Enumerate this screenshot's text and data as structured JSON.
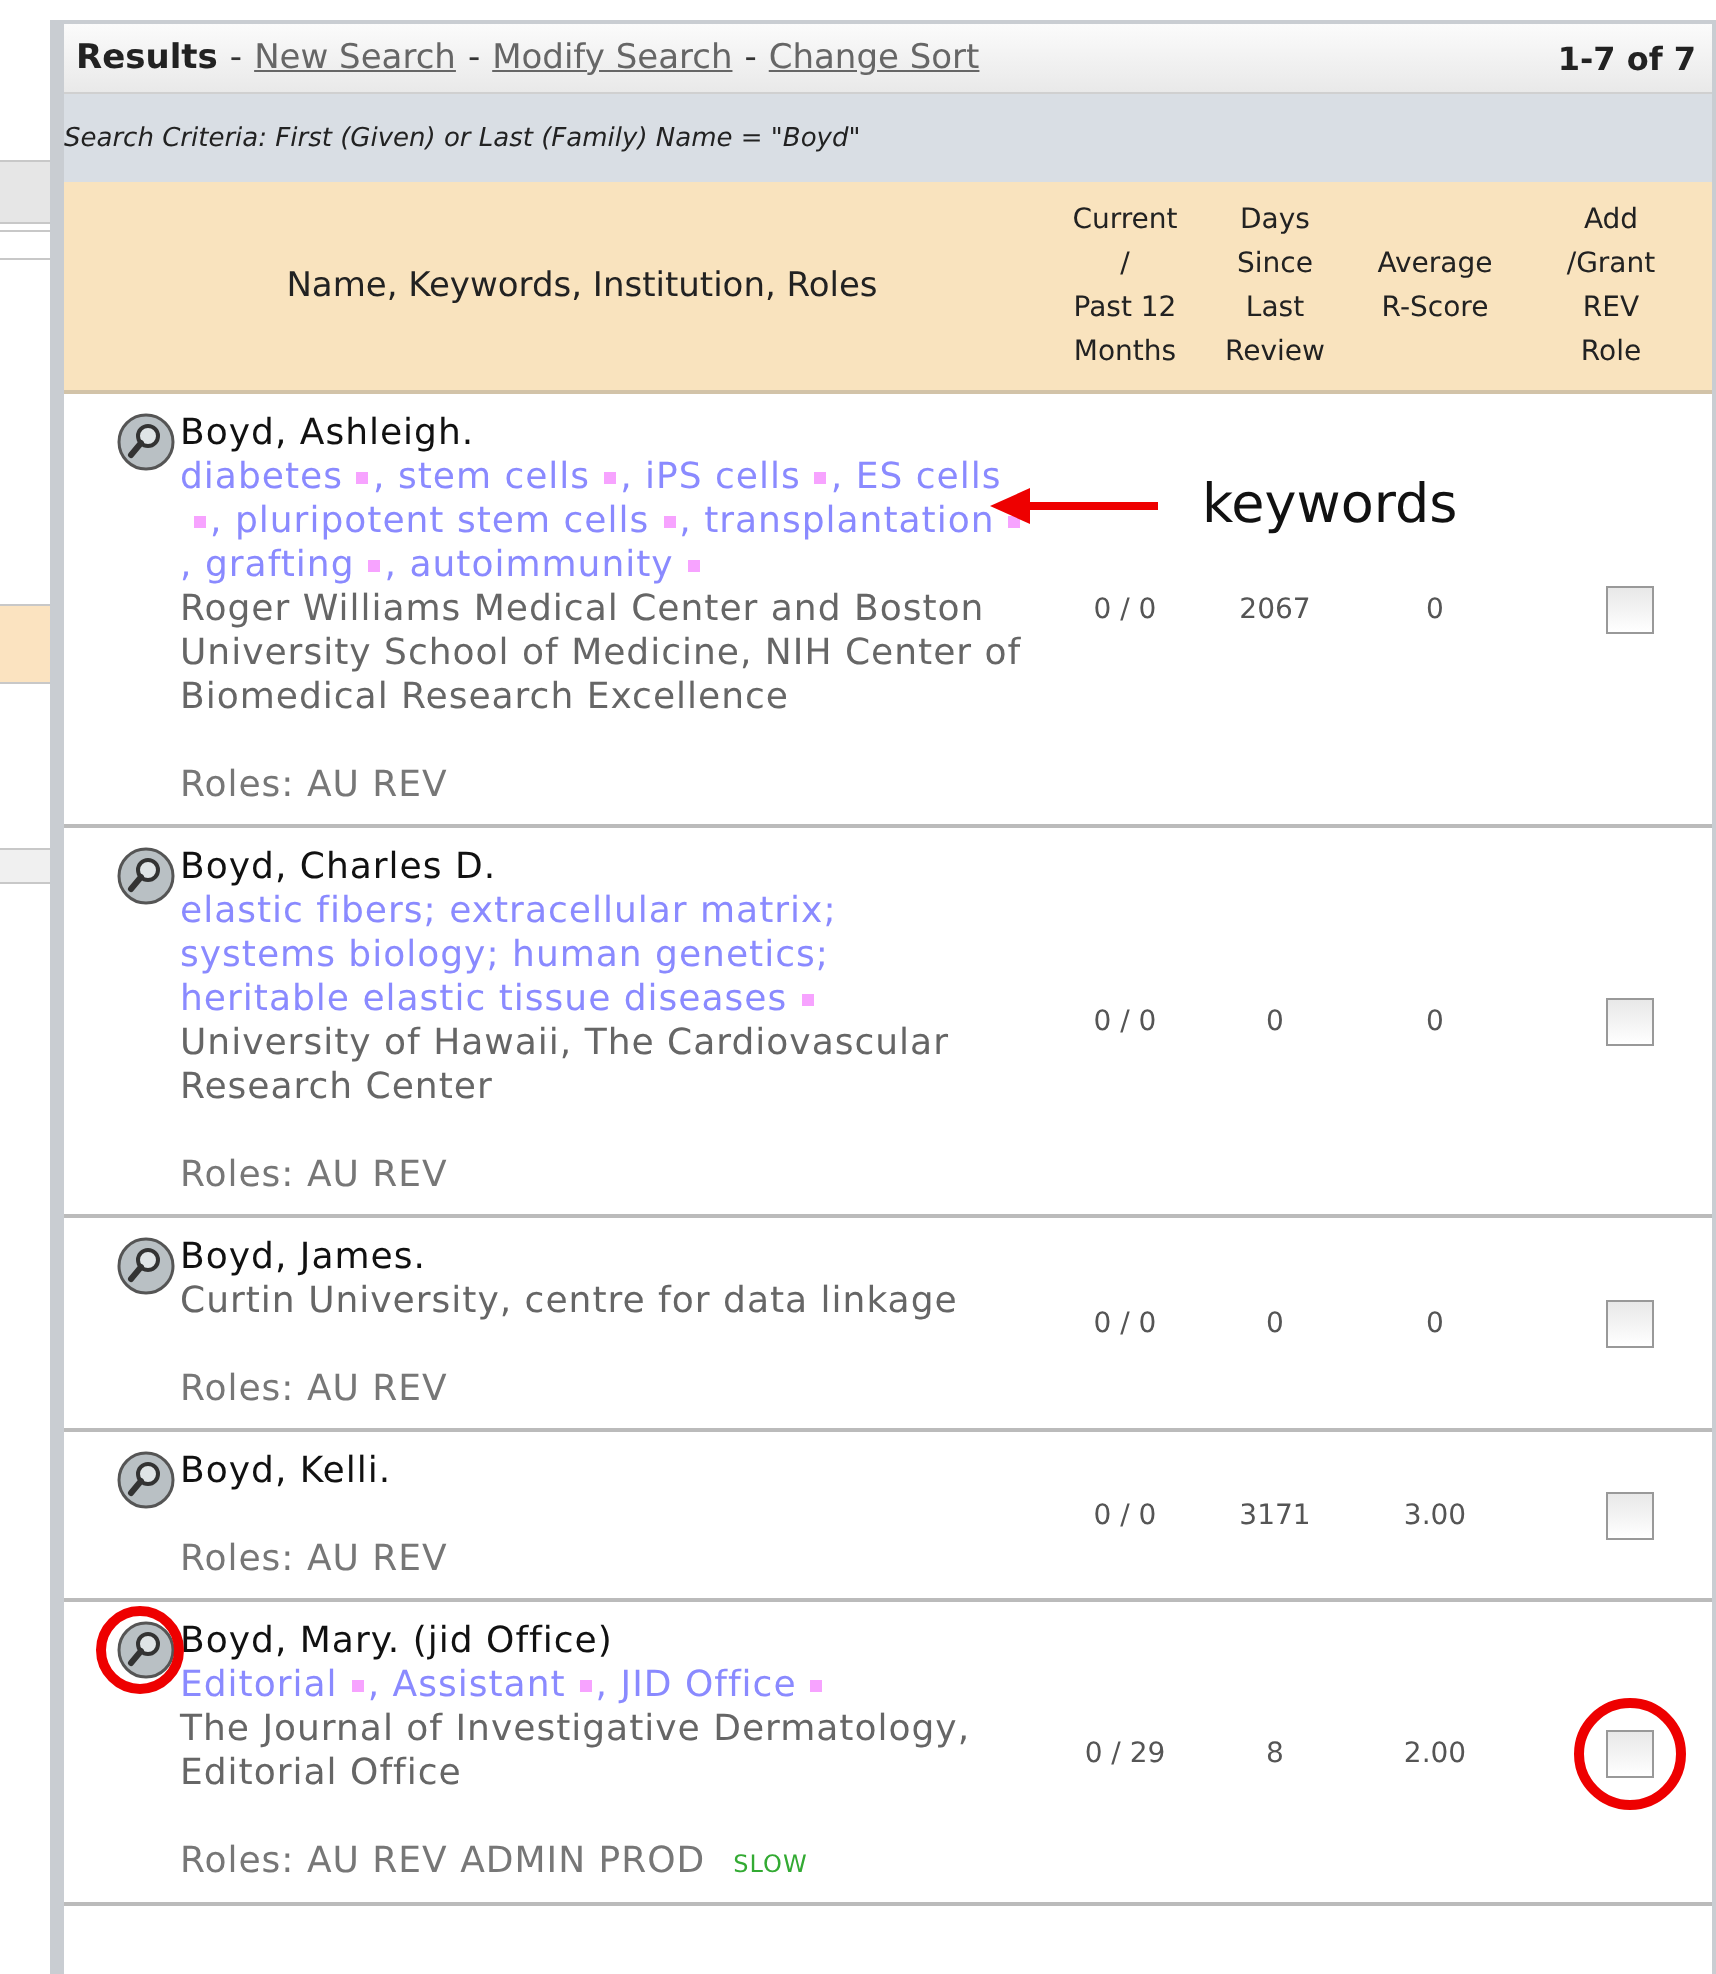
{
  "header": {
    "title": "Results",
    "links": [
      {
        "separator": "-",
        "label": "New Search"
      },
      {
        "separator": "-",
        "label": "Modify Search"
      },
      {
        "separator": "-",
        "label": "Change Sort"
      }
    ],
    "count": "1-7 of 7"
  },
  "criteria": "Search Criteria: First (Given) or Last (Family) Name = \"Boyd\"",
  "columns": [
    "Name, Keywords, Institution, Roles",
    "Current\n/\nPast 12\nMonths",
    "Days\nSince\nLast\nReview",
    "Average\nR-Score",
    "Add\n/Grant\nREV\nRole"
  ],
  "rows": [
    {
      "name": "Boyd, Ashleigh.",
      "keywords": [
        {
          "text": "diabetes",
          "separator": ",",
          "marker": true
        },
        {
          "text": "stem cells",
          "separator": ",",
          "marker": true
        },
        {
          "text": "iPS cells",
          "separator": ",",
          "marker": true
        },
        {
          "text": "ES cells",
          "separator": ",",
          "marker": true
        },
        {
          "text": "pluripotent stem cells",
          "separator": ",",
          "marker": true
        },
        {
          "text": "transplantation",
          "separator": ",",
          "marker": true
        },
        {
          "text": "grafting",
          "separator": ",",
          "marker": true
        },
        {
          "text": "autoimmunity",
          "marker": true
        }
      ],
      "institution": "Roger Williams Medical Center and Boston University School of Medicine, NIH Center of Biomedical Research Excellence",
      "roles": "Roles: AU REV",
      "current": "0 / 0",
      "days": "2067",
      "score": "0",
      "checked": false,
      "highlighted": false
    },
    {
      "name": "Boyd, Charles D.",
      "keywords": [
        {
          "text": "elastic fibers",
          "separator": ";",
          "marker": false
        },
        {
          "text": "extracellular matrix",
          "separator": ";",
          "marker": false
        },
        {
          "text": "systems biology",
          "separator": ";",
          "marker": false
        },
        {
          "text": "human genetics",
          "separator": ";",
          "marker": false
        },
        {
          "text": "heritable elastic tissue diseases",
          "marker": true
        }
      ],
      "institution": "University of Hawaii, The Cardiovascular Research Center",
      "roles": "Roles: AU REV",
      "current": "0 / 0",
      "days": "0",
      "score": "0",
      "checked": false,
      "highlighted": false
    },
    {
      "name": "Boyd, James.",
      "institution": "Curtin University, centre for data linkage",
      "roles": "Roles: AU REV",
      "current": "0 / 0",
      "days": "0",
      "score": "0",
      "checked": false,
      "highlighted": false
    },
    {
      "name": "Boyd, Kelli.",
      "roles": "Roles: AU REV",
      "current": "0 / 0",
      "days": "3171",
      "score": "3.00",
      "checked": false,
      "highlighted": false
    },
    {
      "name": "Boyd, Mary. (jid Office)",
      "keywords": [
        {
          "text": "Editorial",
          "separator": ",",
          "marker": true
        },
        {
          "text": "Assistant",
          "separator": ",",
          "marker": true
        },
        {
          "text": "JID Office",
          "marker": true
        }
      ],
      "institution": "The Journal of Investigative Dermatology, Editorial Office",
      "roles": "Roles: AU REV ADMIN PROD",
      "flag": "SLOW",
      "current": "0 / 29",
      "days": "8",
      "score": "2.00",
      "checked": false,
      "highlighted": true
    }
  ],
  "annotation": {
    "label": "keywords"
  }
}
